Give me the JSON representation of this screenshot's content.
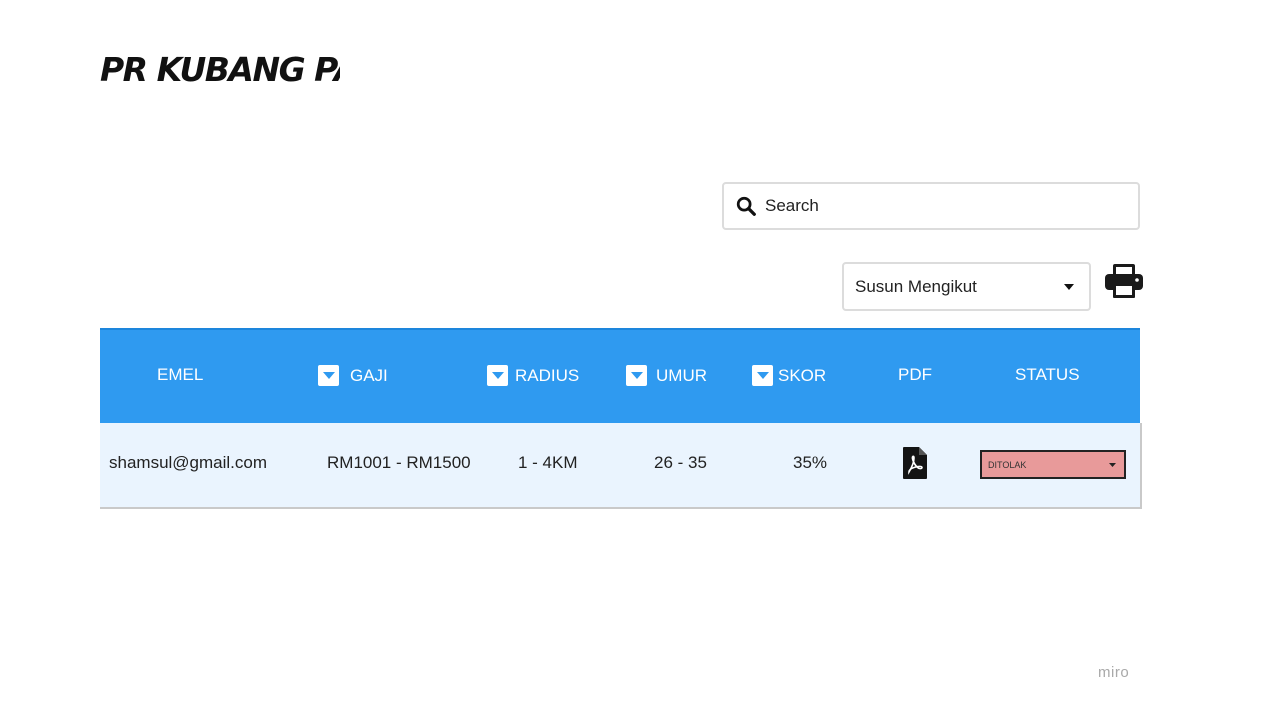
{
  "header": {
    "title": "PR KUBANG PASU"
  },
  "search": {
    "placeholder": "Search"
  },
  "sort": {
    "label": "Susun Mengikut"
  },
  "table": {
    "columns": [
      {
        "label": "EMEL",
        "sortable": false
      },
      {
        "label": "GAJI",
        "sortable": true
      },
      {
        "label": "RADIUS",
        "sortable": true
      },
      {
        "label": "UMUR",
        "sortable": true
      },
      {
        "label": "SKOR",
        "sortable": true
      },
      {
        "label": "PDF",
        "sortable": false
      },
      {
        "label": "STATUS",
        "sortable": false
      }
    ],
    "rows": [
      {
        "email": "shamsul@gmail.com",
        "salary": "RM1001 - RM1500",
        "radius": "1 - 4KM",
        "age": "26 - 35",
        "score": "35%",
        "pdf_icon": "pdf-file-icon",
        "status": "DITOLAK"
      }
    ]
  },
  "icons": {
    "search": "search-icon",
    "print": "printer-icon",
    "sort_caret": "caret-down-icon"
  },
  "colors": {
    "header_bg": "#2f9af0",
    "row_bg": "#eaf4fe",
    "status_rejected_bg": "#e89a9a"
  },
  "watermark": "miro"
}
